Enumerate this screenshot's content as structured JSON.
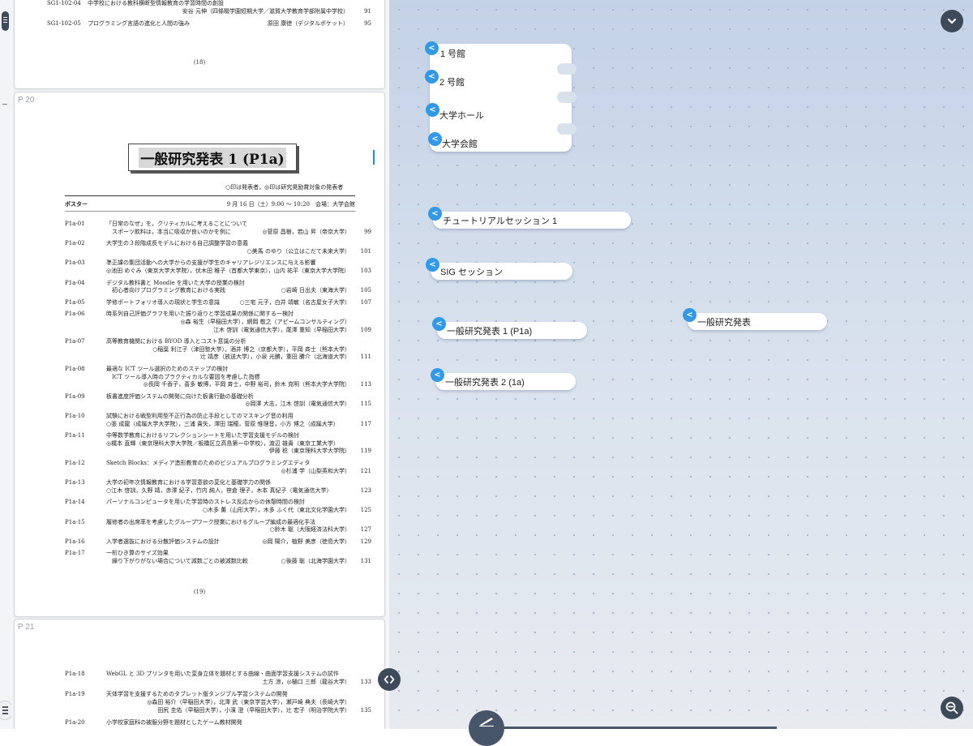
{
  "pdf": {
    "page_top": {
      "rows": [
        {
          "id": "SG1-102-04",
          "title": "中学校における教科横断型情報教育の学習時間の創設",
          "authors": "安谷 元伸（四條畷学園短期大学／滋賀大学教育学部附属中学校）",
          "page": "91"
        },
        {
          "id": "SG1-102-05",
          "title": "プログラミング言語の進化と人間の強み",
          "authors": "原田 康徳（デジタルポケット）",
          "page": "95"
        }
      ],
      "footer": "(18)"
    },
    "page_20": {
      "label": "P 20",
      "session_title": "一般研究発表 1 (P1a)",
      "legend": "○印は発表者，◎印は研究奨励賞対象の発表者",
      "session_kind": "ポスター",
      "session_time": "9 月 16 日（土）9:00 〜 10:20　会場：大学会館",
      "rows": [
        {
          "id": "P1a-01",
          "title": "「日常のなぜ」を，クリティカルに考えることについて",
          "authors": "",
          "page": ""
        },
        {
          "id": "",
          "title": "　スポーツ飲料は，本当に吸収が良いのかを例に",
          "authors": "◎菅原 昌樹，若山 昇（帝京大学）",
          "page": "99"
        },
        {
          "id": "P1a-02",
          "title": "大学生の３段階成長モデルにおける自己調整学習の意義",
          "authors": "",
          "page": ""
        },
        {
          "id": "",
          "title": "",
          "authors": "○美馬 のゆり（公立はこだて未来大学）",
          "page": "101"
        },
        {
          "id": "P1a-03",
          "title": "準正課の集団活動への大学からの支援が学生のキャリアレジリエンスに与える影響",
          "authors": "",
          "page": ""
        },
        {
          "id": "",
          "title": "◎池田 めぐみ（東京大学大学院），伏木田 稚子（首都大学東京），山内 祐平（東京大学大学院）",
          "authors": "",
          "page": "103"
        },
        {
          "id": "P1a-04",
          "title": "デジタル教科書と Moodle を用いた大学の授業の検討",
          "authors": "",
          "page": ""
        },
        {
          "id": "",
          "title": "　初心者向けプログラミング教育における実践",
          "authors": "○岩崎 日出夫（東海大学）",
          "page": "105"
        },
        {
          "id": "P1a-05",
          "title": "学修ポートフォリオ導入の現状と学生の意識",
          "authors": "○三宅 元子，白井 靖敏（名古屋女子大学）",
          "page": "107"
        },
        {
          "id": "P1a-06",
          "title": "時系列自己評価グラフを用いた振り返りと学習成果の関係に関する一検討",
          "authors": "",
          "page": ""
        },
        {
          "id": "",
          "title": "",
          "authors": "◎森 裕生（早稲田大学），網岡 敬之（アビームコンサルティング）",
          "page": ""
        },
        {
          "id": "",
          "title": "",
          "authors": "江木 啓訓（電気通信大学），尾澤 重知（早稲田大学）",
          "page": "109"
        },
        {
          "id": "P1a-07",
          "title": "高等教育機関における BYOD 導入とコスト意識の分析",
          "authors": "",
          "page": ""
        },
        {
          "id": "",
          "title": "",
          "authors": "○稲葉 利江子（津田塾大学），酒井 博之（京都大学），平岡 斉士（熊本大学）",
          "page": ""
        },
        {
          "id": "",
          "title": "",
          "authors": "辻 靖彦（放送大学），小泉 光勝，重田 勝介（北海道大学）",
          "page": "111"
        },
        {
          "id": "P1a-08",
          "title": "最適な ICT ツール選択のためのステップの検討",
          "authors": "",
          "page": ""
        },
        {
          "id": "",
          "title": "　ICT ツール導入時のプラクティカルな要因を考慮した指標",
          "authors": "",
          "page": ""
        },
        {
          "id": "",
          "title": "",
          "authors": "◎長岡 千香子，喜多 敏博，平岡 斉士，中野 裕司，鈴木 克明（熊本大学大学院）",
          "page": "113"
        },
        {
          "id": "P1a-09",
          "title": "板書進度評価システムの開発に向けた板書行動の基礎分析",
          "authors": "",
          "page": ""
        },
        {
          "id": "",
          "title": "",
          "authors": "◎岡澤 大志，江木 啓訓（電気通信大学）",
          "page": "115"
        },
        {
          "id": "P1a-10",
          "title": "試験における戦型利用型不正行為の防止手段としてのマスキング音の利用",
          "authors": "",
          "page": ""
        },
        {
          "id": "",
          "title": "○張 成龍（成蹊大学大学院），三浦 貴矢，澤田 瑞穂，菅原 惟理音，小方 博之（成蹊大学）",
          "authors": "",
          "page": "117"
        },
        {
          "id": "P1a-11",
          "title": "中等数学教育におけるリフレクションシートを用いた学習支援モデルの検討",
          "authors": "",
          "page": ""
        },
        {
          "id": "",
          "title": "◎梶本 直輝（東京理科大学大学院／板橋区立高島第一中学校），渡辺 雄貴（東京工業大学）",
          "authors": "",
          "page": ""
        },
        {
          "id": "",
          "title": "",
          "authors": "伊藤 稔（東京理科大学大学院）",
          "page": "119"
        },
        {
          "id": "P1a-12",
          "title": "Sketch Blocks：メディア造形教育のためのビジュアルプログラミングエディタ",
          "authors": "",
          "page": ""
        },
        {
          "id": "",
          "title": "",
          "authors": "◎杉浦 学（山梨英和大学）",
          "page": "121"
        },
        {
          "id": "P1a-13",
          "title": "大学の初年次情報教育における学習意欲の変化と基礎学力の関係",
          "authors": "",
          "page": ""
        },
        {
          "id": "",
          "title": "○江木 啓訓，久野 靖，赤澤 紀子，竹内 純人，笹倉 理子，木本 真紀子（電気通信大学）",
          "authors": "",
          "page": "123"
        },
        {
          "id": "P1a-14",
          "title": "パーソナルコンピュータを用いた学習時のストレス反応からの休憩時間の検討",
          "authors": "",
          "page": ""
        },
        {
          "id": "",
          "title": "",
          "authors": "○木多 薫（山形大学），木多 ふく代（東北文化学園大学）",
          "page": "125"
        },
        {
          "id": "P1a-15",
          "title": "履修者の出席率を考慮したグループワーク授業におけるグループ編成の最適化手法",
          "authors": "",
          "page": ""
        },
        {
          "id": "",
          "title": "",
          "authors": "○鈴木 聡（大阪経済法科大学）",
          "page": "127"
        },
        {
          "id": "P1a-16",
          "title": "入学者選抜における分散評価システムの設計",
          "authors": "◎岡 陽介，植野 美彦（徳島大学）",
          "page": "129"
        },
        {
          "id": "P1a-17",
          "title": "一桁ひき算のサイズ効果",
          "authors": "",
          "page": ""
        },
        {
          "id": "",
          "title": "　繰り下がりがない場合について減数ごとの被減数比較",
          "authors": "○後藤 聡（北海学園大学）",
          "page": "131"
        }
      ],
      "footer": "(19)"
    },
    "page_21": {
      "label": "P 21",
      "rows": [
        {
          "id": "P1a-18",
          "title": "WebGL と 3D プリンタを用いた変身立体を題材とする曲線・曲面学習支援システムの試作",
          "authors": "",
          "page": ""
        },
        {
          "id": "",
          "title": "",
          "authors": "土方 涼，◎樋口 三郎（龍谷大学）",
          "page": "133"
        },
        {
          "id": "P1a-19",
          "title": "天体学習を支援するためのタブレット版タンジブル学習システムの開発",
          "authors": "",
          "page": ""
        },
        {
          "id": "",
          "title": "",
          "authors": "◎森田 裕介（早稲田大学），北澤 武（東京学芸大学），瀬戸崎 典夫（長崎大学）",
          "page": ""
        },
        {
          "id": "",
          "title": "",
          "authors": "田尻 圭佑（早稲田大学），小濱 澄（早稲田大学），辻 宏子（明治学院大学）",
          "page": "135"
        },
        {
          "id": "P1a-20",
          "title": "小学校家庭科の被服分野を題材としたゲーム教材開発",
          "authors": "",
          "page": ""
        }
      ]
    }
  },
  "mindmap": {
    "buildings": [
      "1 号館",
      "2 号館",
      "大学ホール",
      "大学会館"
    ],
    "nodes": [
      {
        "key": "tutorial",
        "label": "チュートリアルセッション 1"
      },
      {
        "key": "sig",
        "label": "SIG セッション"
      },
      {
        "key": "p1a",
        "label": "一般研究発表 1 (P1a)"
      },
      {
        "key": "p2a",
        "label": "一般研究発表 2 (1a)"
      },
      {
        "key": "general",
        "label": "一般研究発表"
      }
    ],
    "toggle_glyph": "<"
  },
  "colors": {
    "accent": "#3399e6",
    "button": "#3e4a5a",
    "canvas": "#d3ddec"
  }
}
